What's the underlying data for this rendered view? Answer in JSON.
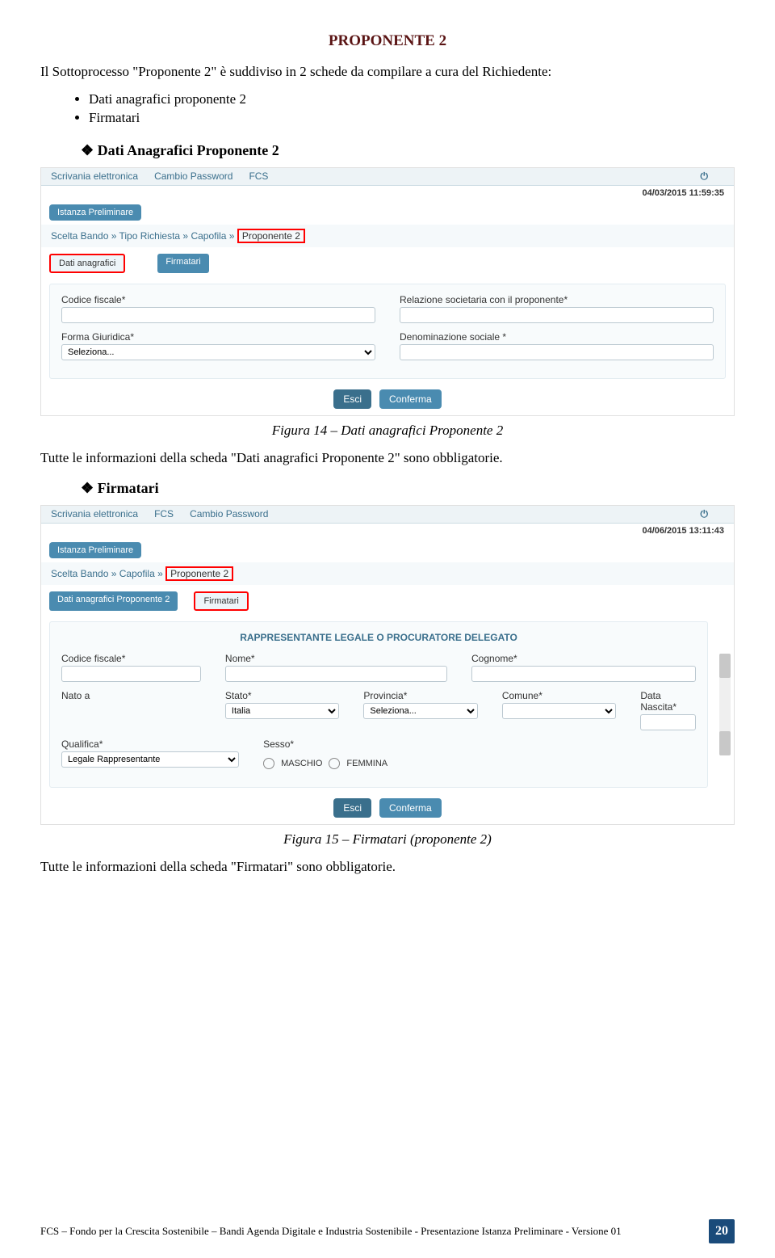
{
  "heading": "PROPONENTE 2",
  "intro": "Il Sottoprocesso \"Proponente 2\" è suddiviso  in 2 schede da compilare a cura del Richiedente:",
  "bullets": [
    "Dati anagrafici proponente 2",
    "Firmatari"
  ],
  "section1_title": "Dati Anagrafici Proponente 2",
  "caption1": "Figura 14 – Dati anagrafici Proponente 2",
  "after1": "Tutte le informazioni della scheda \"Dati anagrafici Proponente 2\" sono obbligatorie.",
  "section2_title": "Firmatari",
  "caption2": "Figura 15 – Firmatari (proponente 2)",
  "after2": "Tutte le informazioni della scheda \"Firmatari\" sono obbligatorie.",
  "footer_text": "FCS – Fondo per la Crescita Sostenibile – Bandi Agenda Digitale e Industria Sostenibile -  Presentazione Istanza Preliminare  - Versione 01",
  "page_number": "20",
  "shot1": {
    "nav": [
      "Scrivania elettronica",
      "Cambio Password",
      "FCS"
    ],
    "ts": "04/03/2015 11:59:35",
    "badge": "Istanza Preliminare",
    "breadcrumb": {
      "prefix": "Scelta Bando » Tipo Richiesta » Capofila »",
      "active": "Proponente 2"
    },
    "tabs": {
      "active": "Dati anagrafici",
      "other": "Firmatari"
    },
    "fields": {
      "cf": "Codice fiscale*",
      "rel": "Relazione societaria con il proponente*",
      "forma": "Forma Giuridica*",
      "forma_val": "Seleziona...",
      "denom": "Denominazione sociale *"
    },
    "btn_esci": "Esci",
    "btn_conf": "Conferma"
  },
  "shot2": {
    "nav": [
      "Scrivania elettronica",
      "FCS",
      "Cambio Password"
    ],
    "ts": "04/06/2015 13:11:43",
    "badge": "Istanza Preliminare",
    "breadcrumb": {
      "prefix": "Scelta Bando » Capofila »",
      "active": "Proponente 2"
    },
    "tabs": {
      "left": "Dati anagrafici Proponente 2",
      "active": "Firmatari"
    },
    "formheader": "RAPPRESENTANTE LEGALE O PROCURATORE DELEGATO",
    "fields": {
      "cf": "Codice fiscale*",
      "nome": "Nome*",
      "cognome": "Cognome*",
      "nato": "Nato a",
      "stato": "Stato*",
      "stato_val": "Italia",
      "prov": "Provincia*",
      "prov_val": "Seleziona...",
      "comune": "Comune*",
      "data": "Data Nascita*",
      "qual": "Qualifica*",
      "qual_val": "Legale Rappresentante",
      "sesso": "Sesso*",
      "sesso_m": "MASCHIO",
      "sesso_f": "FEMMINA"
    },
    "btn_esci": "Esci",
    "btn_conf": "Conferma"
  }
}
